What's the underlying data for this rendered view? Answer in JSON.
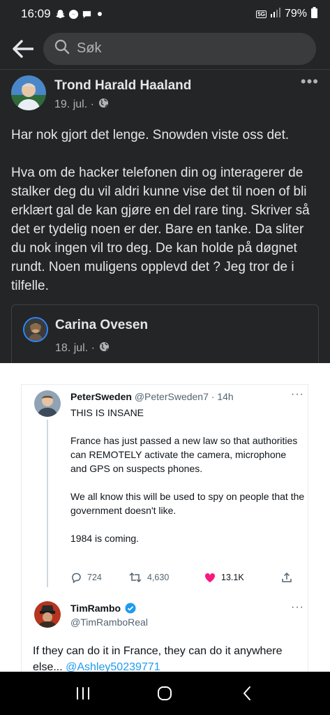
{
  "status": {
    "time": "16:09",
    "battery": "79%"
  },
  "search": {
    "placeholder": "Søk"
  },
  "post": {
    "author": "Trond Harald Haaland",
    "date": "19. jul. ·",
    "paragraphs": [
      "Har nok gjort det lenge. Snowden viste oss det.",
      "Hva om de hacker telefonen din og interagerer de stalker deg du vil aldri kunne vise det til noen of bli erklært gal de kan gjøre en del rare ting. Skriver så det er tydelig noen er der. Bare en tanke. Da sliter du nok ingen vil tro deg. De kan holde på døgnet rundt. Noen muligens opplevd det ? Jeg tror de i tilfelle."
    ]
  },
  "shared": {
    "author": "Carina Ovesen",
    "date": "18. jul. ·"
  },
  "tweet1": {
    "name": "PeterSweden",
    "handle": "@PeterSweden7 · 14h",
    "lines": [
      "THIS IS INSANE",
      "France has just passed a new law so that authorities can REMOTELY activate the camera, microphone and GPS on suspects phones.",
      "We all know this will be used to spy on people that the government doesn't like.",
      "1984 is coming."
    ],
    "replies": "724",
    "retweets": "4,630",
    "likes": "13.1K"
  },
  "tweet2": {
    "name": "TimRambo",
    "handle": "@TimRamboReal",
    "text": "If they can do it in France, they can do it anywhere else... ",
    "mention": "@Ashley50239771"
  },
  "colors": {
    "background": "#242526",
    "verified": "#1d9bf0",
    "like": "#f91880",
    "link": "#1d9bf0"
  }
}
